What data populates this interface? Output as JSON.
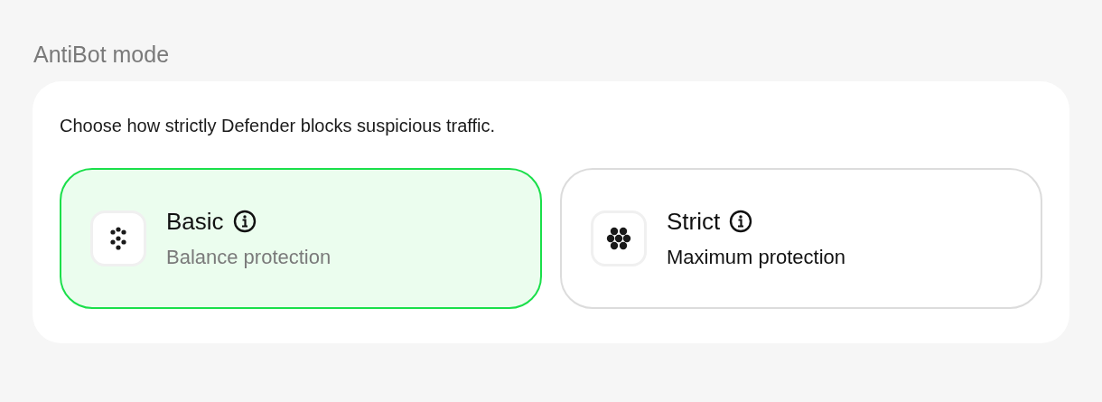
{
  "section_title": "AntiBot mode",
  "description": "Choose how strictly Defender blocks suspicious traffic.",
  "options": [
    {
      "kind": "sparse",
      "title": "Basic",
      "subtitle": "Balance protection",
      "selected": true
    },
    {
      "kind": "dense",
      "title": "Strict",
      "subtitle": "Maximum protection",
      "selected": false
    }
  ]
}
